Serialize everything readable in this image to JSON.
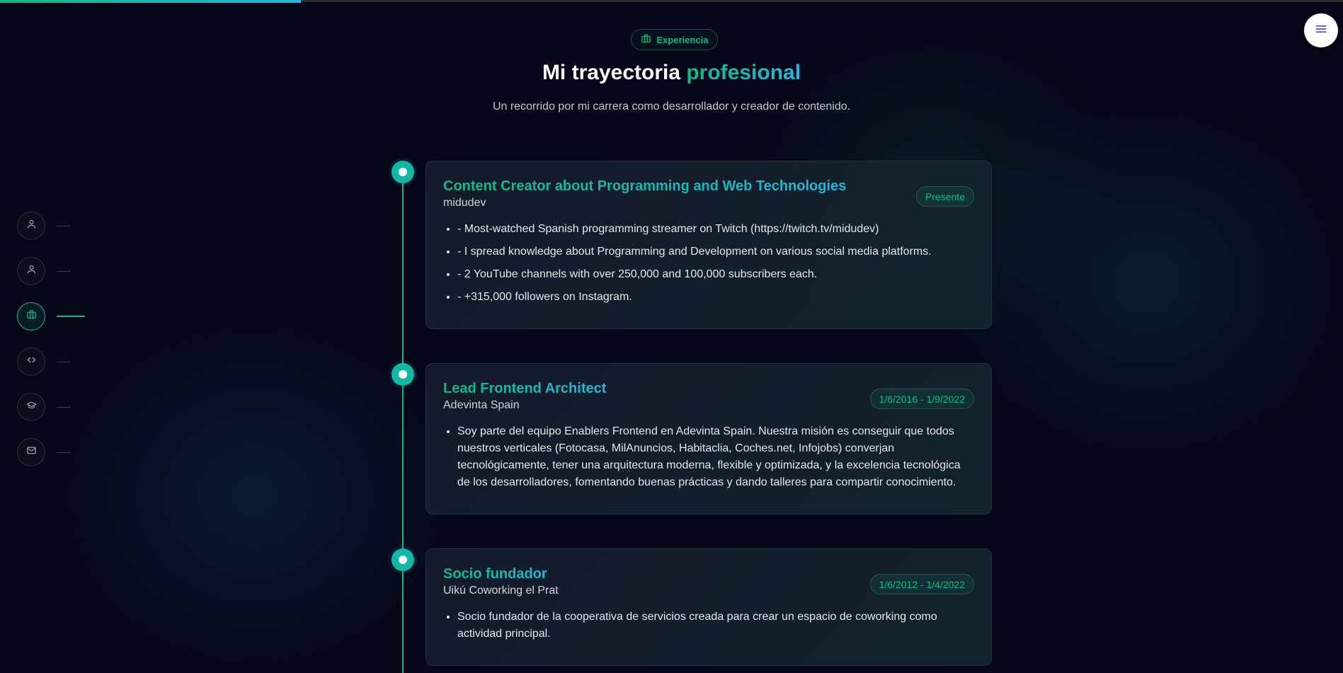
{
  "header": {
    "badge_label": "Experiencia",
    "title_main": "Mi trayectoria",
    "title_accent": "profesional",
    "subtitle": "Un recorrido por mi carrera como desarrollador y creador de contenido."
  },
  "sidenav": {
    "items": [
      {
        "icon": "user-icon",
        "active": false
      },
      {
        "icon": "user-icon",
        "active": false
      },
      {
        "icon": "briefcase-icon",
        "active": true
      },
      {
        "icon": "code-icon",
        "active": false
      },
      {
        "icon": "graduation-cap-icon",
        "active": false
      },
      {
        "icon": "mail-icon",
        "active": false
      }
    ]
  },
  "progress_fraction": 0.224,
  "experience": [
    {
      "title": "Content Creator about Programming and Web Technologies",
      "company": "midudev",
      "date": "Presente",
      "bullets": [
        "- Most-watched Spanish programming streamer on Twitch (https://twitch.tv/midudev)",
        "- I spread knowledge about Programming and Development on various social media platforms.",
        "- 2 YouTube channels with over 250,000 and 100,000 subscribers each.",
        "- +315,000 followers on Instagram."
      ]
    },
    {
      "title": "Lead Frontend Architect",
      "company": "Adevinta Spain",
      "date": "1/6/2016 - 1/9/2022",
      "bullets": [
        "Soy parte del equipo Enablers Frontend en Adevinta Spain. Nuestra misión es conseguir que todos nuestros verticales (Fotocasa, MilAnuncios, Habitaclia, Coches.net, Infojobs) converjan tecnológicamente, tener una arquitectura moderna, flexible y optimizada, y la excelencia tecnológica de los desarrolladores, fomentando buenas prácticas y dando talleres para compartir conocimiento."
      ]
    },
    {
      "title": "Socio fundador",
      "company": "Uikú Coworking el Prat",
      "date": "1/6/2012 - 1/4/2022",
      "bullets": [
        "Socio fundador de la cooperativa de servicios creada para crear un espacio de coworking como actividad principal."
      ]
    }
  ],
  "colors": {
    "accent": "#10b981",
    "accent2": "#22b8e0",
    "background": "#060718"
  }
}
